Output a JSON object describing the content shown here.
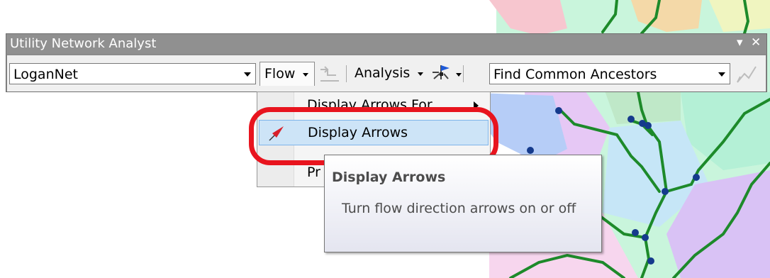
{
  "toolbar": {
    "title": "Utility Network Analyst",
    "network_select": {
      "value": "LoganNet"
    },
    "flow_menu_label": "Flow",
    "analysis_menu_label": "Analysis",
    "task_select": {
      "value": "Find Common Ancestors"
    }
  },
  "flow_menu": {
    "items": [
      {
        "label": "Display Arrows For",
        "has_submenu": true
      },
      {
        "label": "Display Arrows",
        "highlighted": true,
        "icon": "flow-arrow-icon"
      },
      {
        "label": "Pr"
      }
    ]
  },
  "tooltip": {
    "title": "Display Arrows",
    "body": "Turn flow direction arrows on or off"
  },
  "colors": {
    "annotation": "#e8141e",
    "highlight": "#cde4f7",
    "network_line": "#1d8a2a"
  }
}
